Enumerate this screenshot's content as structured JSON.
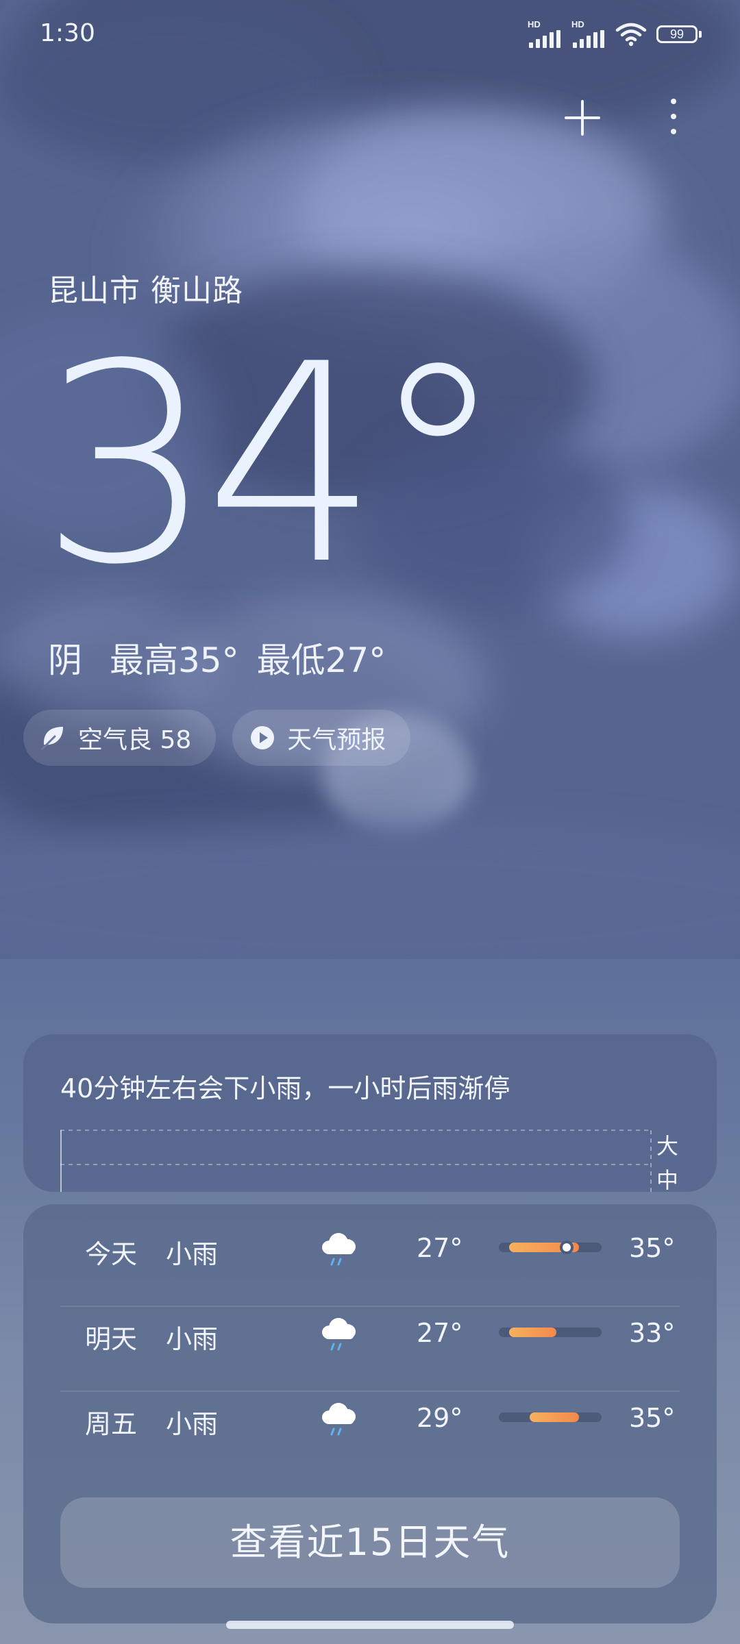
{
  "status_bar": {
    "time": "1:30",
    "signal1_label": "HD",
    "signal2_label": "HD",
    "battery": "99",
    "icons": [
      "signal-icon",
      "signal-icon",
      "wifi-icon",
      "battery-icon"
    ]
  },
  "header": {
    "actions": [
      "add-icon",
      "more-vertical-icon"
    ]
  },
  "current": {
    "location": "昆山市 衡山路",
    "temperature": "34°",
    "condition": "阴",
    "high": "最高35°",
    "low": "最低27°"
  },
  "chips": {
    "air_quality": "空气良 58",
    "forecast_video": "天气预报"
  },
  "rain": {
    "summary": "40分钟左右会下小雨，一小时后雨渐停",
    "level_heavy": "大",
    "level_medium": "中"
  },
  "forecast": {
    "days": [
      {
        "day": "今天",
        "desc": "小雨",
        "icon": "rain-cloud-icon",
        "low": "27°",
        "high": "35°",
        "bar_start": 0.1,
        "bar_end": 0.78,
        "current_marker": 0.66
      },
      {
        "day": "明天",
        "desc": "小雨",
        "icon": "rain-cloud-icon",
        "low": "27°",
        "high": "33°",
        "bar_start": 0.1,
        "bar_end": 0.56
      },
      {
        "day": "周五",
        "desc": "小雨",
        "icon": "rain-cloud-icon",
        "low": "29°",
        "high": "35°",
        "bar_start": 0.3,
        "bar_end": 0.78
      }
    ],
    "more_button": "查看近15日天气"
  },
  "colors": {
    "temp_bar_start": "#f7b15e",
    "temp_bar_end": "#f3894c",
    "rain_drop": "#5fb4f0"
  }
}
